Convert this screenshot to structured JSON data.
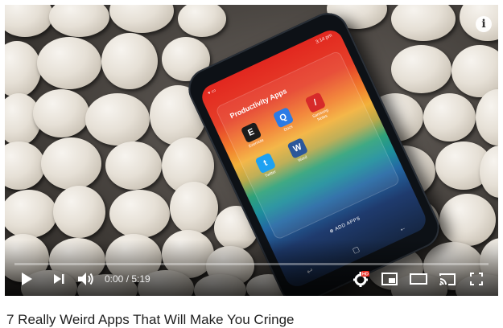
{
  "player": {
    "phone_screen": {
      "status_time": "3:14 pm",
      "folder_title": "Productivity Apps",
      "apps": [
        {
          "label": "Evernote",
          "icon": "evernote-icon",
          "color": "#1b1b1b",
          "glyph": "E"
        },
        {
          "label": "Docs",
          "icon": "docs-icon",
          "color": "#2c7be5",
          "glyph": "Q"
        },
        {
          "label": "Samsung Notes",
          "icon": "pen-icon",
          "color": "#d72a2a",
          "glyph": "/"
        },
        {
          "label": "Twitter",
          "icon": "twitter-icon",
          "color": "#1da1f2",
          "glyph": "t"
        },
        {
          "label": "Word",
          "icon": "word-icon",
          "color": "#2b579a",
          "glyph": "W"
        }
      ],
      "add_apps": "ADD APPS"
    },
    "progress": 0,
    "time": "0:00 / 5:19",
    "accent": "#ff0000"
  },
  "video": {
    "title": "7 Really Weird Apps That Will Make You Cringe"
  }
}
